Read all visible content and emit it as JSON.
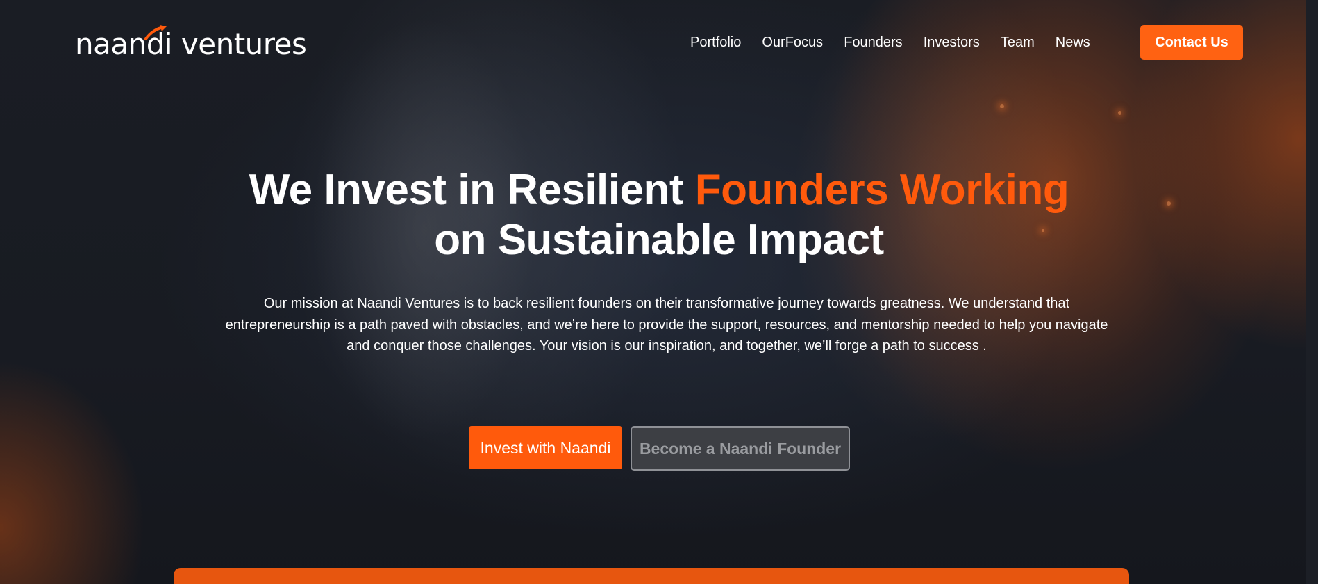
{
  "brand": {
    "logo_text": "naandi ventures",
    "accent_color": "#ff5a0c"
  },
  "nav": {
    "items": [
      {
        "label": "Portfolio"
      },
      {
        "label": "OurFocus"
      },
      {
        "label": "Founders"
      },
      {
        "label": "Investors"
      },
      {
        "label": "Team"
      },
      {
        "label": "News"
      }
    ],
    "contact_label": "Contact Us"
  },
  "hero": {
    "title_part1": "We Invest in Resilient ",
    "title_accent": "Founders Working",
    "title_part2": "on Sustainable Impact",
    "description": "Our mission at Naandi Ventures is to back resilient founders on their transformative journey towards greatness. We understand that entrepreneurship is a path paved with obstacles, and we’re here to provide the support, resources, and mentorship needed to help you navigate and conquer those challenges. Your vision is our inspiration, and together, we’ll forge a path to success .",
    "primary_cta": "Invest with Naandi",
    "secondary_cta": "Become a Naandi Founder"
  }
}
